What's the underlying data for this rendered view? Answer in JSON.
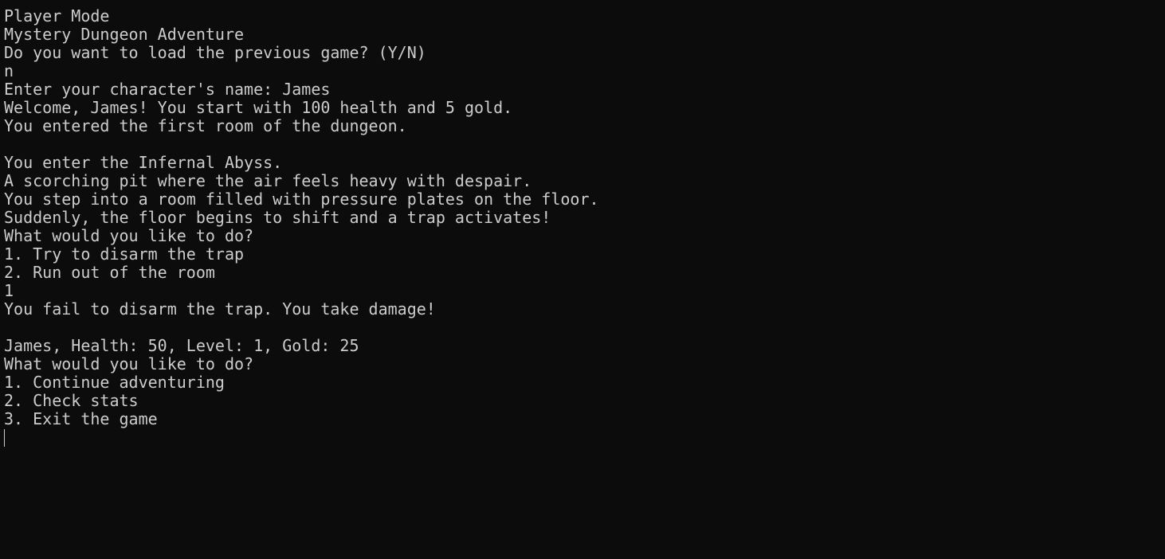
{
  "terminal": {
    "lines": [
      "Player Mode",
      "Mystery Dungeon Adventure",
      "Do you want to load the previous game? (Y/N)",
      "n",
      "Enter your character's name: James",
      "Welcome, James! You start with 100 health and 5 gold.",
      "You entered the first room of the dungeon.",
      "",
      "You enter the Infernal Abyss.",
      "A scorching pit where the air feels heavy with despair.",
      "You step into a room filled with pressure plates on the floor.",
      "Suddenly, the floor begins to shift and a trap activates!",
      "What would you like to do?",
      "1. Try to disarm the trap",
      "2. Run out of the room",
      "1",
      "You fail to disarm the trap. You take damage!",
      "",
      "James, Health: 50, Level: 1, Gold: 25",
      "What would you like to do?",
      "1. Continue adventuring",
      "2. Check stats",
      "3. Exit the game"
    ]
  },
  "colors": {
    "background": "#0c0c0c",
    "foreground": "#cccccc"
  }
}
